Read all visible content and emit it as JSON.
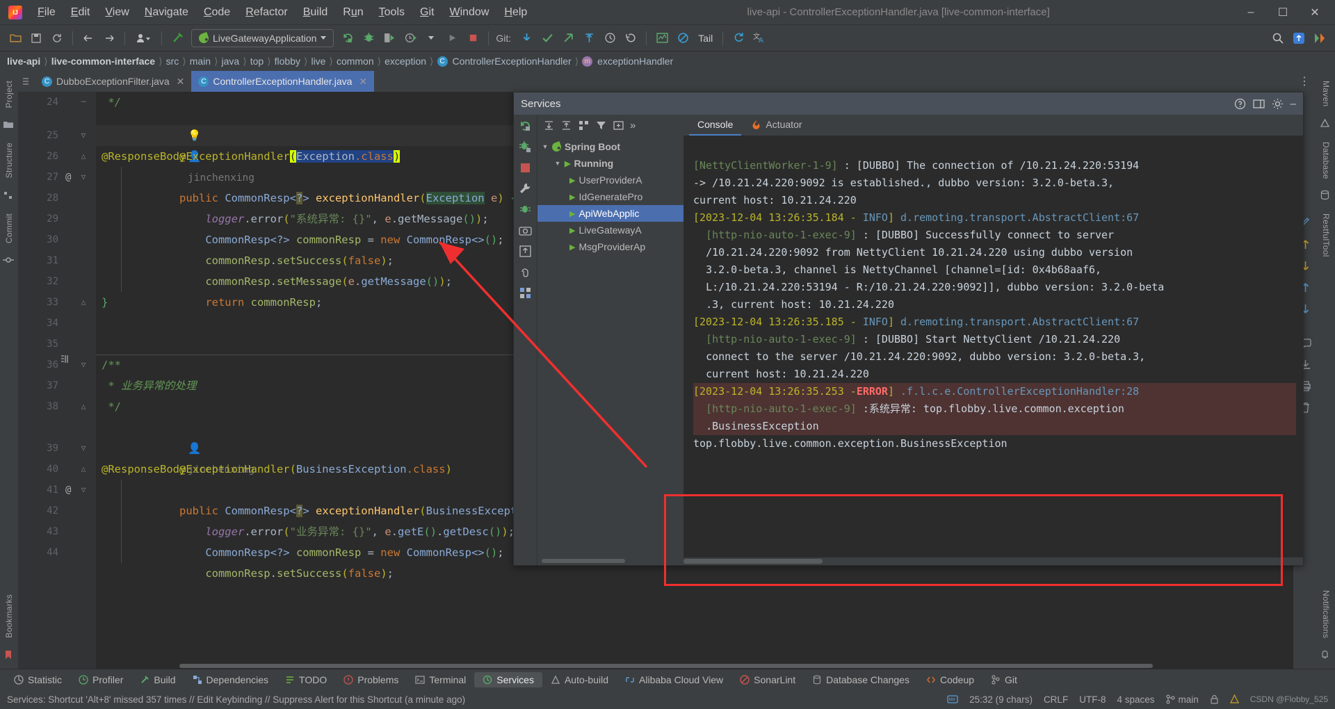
{
  "window": {
    "title": "live-api - ControllerExceptionHandler.java [live-common-interface]",
    "minimize": "–",
    "maximize": "❐",
    "close": "✕"
  },
  "menu": [
    {
      "label": "File",
      "mnemonic": "F"
    },
    {
      "label": "Edit",
      "mnemonic": "E"
    },
    {
      "label": "View",
      "mnemonic": "V"
    },
    {
      "label": "Navigate",
      "mnemonic": "N"
    },
    {
      "label": "Code",
      "mnemonic": "C"
    },
    {
      "label": "Refactor",
      "mnemonic": "R"
    },
    {
      "label": "Build",
      "mnemonic": "B"
    },
    {
      "label": "Run",
      "mnemonic": "u"
    },
    {
      "label": "Tools",
      "mnemonic": "T"
    },
    {
      "label": "Git",
      "mnemonic": "G"
    },
    {
      "label": "Window",
      "mnemonic": "W"
    },
    {
      "label": "Help",
      "mnemonic": "H"
    }
  ],
  "toolbar": {
    "run_config": "LiveGatewayApplication",
    "git_label": "Git:",
    "tail_label": "Tail",
    "icons": [
      "open-folder-icon",
      "save-icon",
      "sync-icon",
      "back-arrow-icon",
      "forward-arrow-icon",
      "profile-icon",
      "build-hammer-icon",
      "run-icon",
      "debug-icon",
      "run-with-coverage-icon",
      "profiler-icon",
      "play-icon",
      "stop-icon",
      "update-project-icon",
      "commit-icon",
      "push-icon",
      "checkout-icon",
      "history-icon",
      "rollback-icon",
      "chart-icon",
      "no-entry-icon",
      "refresh-icon",
      "translate-icon",
      "search-everywhere-icon",
      "notifications-icon",
      "settings-icon"
    ]
  },
  "breadcrumb": [
    {
      "label": "live-api",
      "bold": true,
      "icon": null
    },
    {
      "label": "live-common-interface",
      "bold": true,
      "icon": null
    },
    {
      "label": "src",
      "bold": false,
      "icon": null
    },
    {
      "label": "main",
      "bold": false,
      "icon": null
    },
    {
      "label": "java",
      "bold": false,
      "icon": null
    },
    {
      "label": "top",
      "bold": false,
      "icon": null
    },
    {
      "label": "flobby",
      "bold": false,
      "icon": null
    },
    {
      "label": "live",
      "bold": false,
      "icon": null
    },
    {
      "label": "common",
      "bold": false,
      "icon": null
    },
    {
      "label": "exception",
      "bold": false,
      "icon": null
    },
    {
      "label": "ControllerExceptionHandler",
      "bold": false,
      "icon": "class-icon"
    },
    {
      "label": "exceptionHandler",
      "bold": false,
      "icon": "method-icon"
    }
  ],
  "editor_tabs": [
    {
      "label": "DubboExceptionFilter.java",
      "active": false,
      "icon": "java-class-icon"
    },
    {
      "label": "ControllerExceptionHandler.java",
      "active": true,
      "icon": "java-class-icon"
    }
  ],
  "left_rail": [
    "Project",
    "Structure",
    "Commit",
    "Bookmarks"
  ],
  "right_rail": [
    "Maven",
    "Database",
    "RestfulTool",
    "Notifications"
  ],
  "code": {
    "author_tag": "jinchenxing",
    "lines": [
      {
        "n": "24",
        "text": " */",
        "kind": "comment-end"
      },
      {
        "n": "",
        "text": "jinchenxing",
        "kind": "author"
      },
      {
        "n": "25",
        "text": "@ExceptionHandler(Exception.class)",
        "kind": "annotation-selected"
      },
      {
        "n": "26",
        "text": "@ResponseBody",
        "kind": "annotation"
      },
      {
        "n": "27",
        "text": "public CommonResp<?> exceptionHandler(Exception e) {",
        "kind": "method-decl",
        "gutter_annot": "@"
      },
      {
        "n": "28",
        "text": "    logger.error(\"系统异常: {}\", e.getMessage());",
        "kind": "stmt"
      },
      {
        "n": "29",
        "text": "    CommonResp<?> commonResp = new CommonResp<>();",
        "kind": "stmt"
      },
      {
        "n": "30",
        "text": "    commonResp.setSuccess(false);",
        "kind": "stmt"
      },
      {
        "n": "31",
        "text": "    commonResp.setMessage(e.getMessage());",
        "kind": "stmt"
      },
      {
        "n": "32",
        "text": "    return commonResp;",
        "kind": "stmt"
      },
      {
        "n": "33",
        "text": "}",
        "kind": "brace"
      },
      {
        "n": "34",
        "text": "",
        "kind": "blank"
      },
      {
        "n": "35",
        "text": "",
        "kind": "blank"
      },
      {
        "n": "36",
        "text": "/**",
        "kind": "comment"
      },
      {
        "n": "37",
        "text": " * 业务异常的处理",
        "kind": "comment"
      },
      {
        "n": "38",
        "text": " */",
        "kind": "comment"
      },
      {
        "n": "",
        "text": "jinchenxing",
        "kind": "author"
      },
      {
        "n": "39",
        "text": "@ExceptionHandler(BusinessException.class)",
        "kind": "annotation"
      },
      {
        "n": "40",
        "text": "@ResponseBody",
        "kind": "annotation"
      },
      {
        "n": "41",
        "text": "public CommonResp<?> exceptionHandler(BusinessException e) {",
        "kind": "method-decl",
        "gutter_annot": "@"
      },
      {
        "n": "42",
        "text": "    logger.error(\"业务异常: {}\", e.getE().getDesc());",
        "kind": "stmt"
      },
      {
        "n": "43",
        "text": "    CommonResp<?> commonResp = new CommonResp<>();",
        "kind": "stmt"
      },
      {
        "n": "44",
        "text": "    commonResp.setSuccess(false);",
        "kind": "stmt"
      }
    ]
  },
  "services": {
    "title": "Services",
    "header_icons": [
      "help-icon",
      "layout-icon",
      "settings-icon",
      "minimize-icon"
    ],
    "toolbar_icons": [
      "rerun-icon",
      "debug-icon",
      "stop-icon",
      "settings-wrench-icon",
      "thread-dump-icon",
      "camera-icon",
      "export-icon",
      "attach-icon",
      "grid-icon"
    ],
    "tree_toolbar_icons": [
      "rerun-icon",
      "expand-all-icon",
      "collapse-all-icon",
      "group-icon",
      "filter-icon",
      "add-tab-icon",
      "more-icon"
    ],
    "tree": [
      {
        "label": "Spring Boot",
        "level": 0,
        "expanded": true,
        "icon": "spring-boot-icon",
        "selected": false
      },
      {
        "label": "Running",
        "level": 1,
        "expanded": true,
        "icon": "run-icon",
        "selected": false
      },
      {
        "label": "UserProviderA",
        "level": 2,
        "expanded": false,
        "icon": "run-icon",
        "selected": false
      },
      {
        "label": "IdGeneratePro",
        "level": 2,
        "expanded": false,
        "icon": "run-icon",
        "selected": false
      },
      {
        "label": "ApiWebApplic",
        "level": 2,
        "expanded": false,
        "icon": "run-icon",
        "selected": true
      },
      {
        "label": "LiveGatewayA",
        "level": 2,
        "expanded": false,
        "icon": "run-icon",
        "selected": false
      },
      {
        "label": "MsgProviderAp",
        "level": 2,
        "expanded": false,
        "icon": "run-icon",
        "selected": false
      }
    ],
    "tabs": [
      {
        "label": "Console",
        "active": true,
        "icon": null
      },
      {
        "label": "Actuator",
        "active": false,
        "icon": "actuator-flame-icon"
      }
    ],
    "console_lines": [
      {
        "segments": [
          {
            "t": "[NettyClientWorker-1-9]",
            "c": "thread"
          },
          {
            "t": " : [DUBBO] The connection of /10.21.24.220:53194",
            "c": "plain"
          }
        ]
      },
      {
        "segments": [
          {
            "t": "-> /10.21.24.220:9092 is established., dubbo version: 3.2.0-beta.3,",
            "c": "plain"
          }
        ],
        "indent": 1
      },
      {
        "segments": [
          {
            "t": "current host: 10.21.24.220",
            "c": "plain"
          }
        ],
        "indent": 1
      },
      {
        "segments": [
          {
            "t": "[2023-12-04 13:26:35.184 - ",
            "c": "time"
          },
          {
            "t": "INFO",
            "c": "info"
          },
          {
            "t": "] ",
            "c": "time"
          },
          {
            "t": "d.remoting.transport.AbstractClient:67",
            "c": "logger"
          }
        ]
      },
      {
        "segments": [
          {
            "t": "[http-nio-auto-1-exec-9]",
            "c": "thread"
          },
          {
            "t": " : [DUBBO] Successfully connect to server",
            "c": "plain"
          }
        ],
        "indent": 1
      },
      {
        "segments": [
          {
            "t": "/10.21.24.220:9092 from NettyClient 10.21.24.220 using dubbo version",
            "c": "plain"
          }
        ],
        "indent": 1
      },
      {
        "segments": [
          {
            "t": "3.2.0-beta.3, channel is NettyChannel [channel=[id: 0x4b68aaf6,",
            "c": "plain"
          }
        ],
        "indent": 1
      },
      {
        "segments": [
          {
            "t": "L:/10.21.24.220:53194 - R:/10.21.24.220:9092]], dubbo version: 3.2.0-beta",
            "c": "plain"
          }
        ],
        "indent": 1
      },
      {
        "segments": [
          {
            "t": ".3, current host: 10.21.24.220",
            "c": "plain"
          }
        ],
        "indent": 1
      },
      {
        "segments": [
          {
            "t": "[2023-12-04 13:26:35.185 - ",
            "c": "time"
          },
          {
            "t": "INFO",
            "c": "info"
          },
          {
            "t": "] ",
            "c": "time"
          },
          {
            "t": "d.remoting.transport.AbstractClient:67",
            "c": "logger"
          }
        ]
      },
      {
        "segments": [
          {
            "t": "[http-nio-auto-1-exec-9]",
            "c": "thread"
          },
          {
            "t": " : [DUBBO] Start NettyClient /10.21.24.220",
            "c": "plain"
          }
        ],
        "indent": 1
      },
      {
        "segments": [
          {
            "t": "connect to the server /10.21.24.220:9092, dubbo version: 3.2.0-beta.3,",
            "c": "plain"
          }
        ],
        "indent": 1
      },
      {
        "segments": [
          {
            "t": "current host: 10.21.24.220",
            "c": "plain"
          }
        ],
        "indent": 1
      }
    ],
    "error_lines": [
      {
        "segments": [
          {
            "t": "[2023-12-04 13:26:35.253 -",
            "c": "time"
          },
          {
            "t": "ERROR",
            "c": "err"
          },
          {
            "t": "] ",
            "c": "time"
          },
          {
            "t": ".f.l.c.e.ControllerExceptionHandler:28",
            "c": "logger"
          }
        ],
        "highlight": true
      },
      {
        "segments": [
          {
            "t": "[http-nio-auto-1-exec-9]",
            "c": "thread"
          },
          {
            "t": " :系统异常: top.flobby.live.common.exception",
            "c": "plain"
          }
        ],
        "indent": 1,
        "highlight": true
      },
      {
        "segments": [
          {
            "t": ".BusinessException",
            "c": "plain"
          }
        ],
        "indent": 1,
        "highlight": true
      },
      {
        "segments": [
          {
            "t": "top.flobby.live.common.exception.BusinessException",
            "c": "plain"
          }
        ],
        "highlight": false
      }
    ]
  },
  "toolwindow_bar": [
    {
      "label": "Statistic",
      "icon": "statistic-icon",
      "active": false
    },
    {
      "label": "Profiler",
      "icon": "profiler-icon",
      "active": false
    },
    {
      "label": "Build",
      "icon": "build-icon",
      "active": false
    },
    {
      "label": "Dependencies",
      "icon": "dependencies-icon",
      "active": false
    },
    {
      "label": "TODO",
      "icon": "todo-icon",
      "active": false
    },
    {
      "label": "Problems",
      "icon": "problems-icon",
      "active": false
    },
    {
      "label": "Terminal",
      "icon": "terminal-icon",
      "active": false
    },
    {
      "label": "Services",
      "icon": "services-icon",
      "active": true
    },
    {
      "label": "Auto-build",
      "icon": "autobuild-icon",
      "active": false
    },
    {
      "label": "Alibaba Cloud View",
      "icon": "alibaba-icon",
      "active": false
    },
    {
      "label": "SonarLint",
      "icon": "sonarlint-icon",
      "active": false
    },
    {
      "label": "Database Changes",
      "icon": "database-icon",
      "active": false
    },
    {
      "label": "Codeup",
      "icon": "codeup-icon",
      "active": false
    },
    {
      "label": "Git",
      "icon": "git-icon",
      "active": false
    }
  ],
  "statusbar": {
    "message": "Services: Shortcut 'Alt+8' missed 357 times // Edit Keybinding // Suppress Alert for this Shortcut (a minute ago)",
    "position": "25:32 (9 chars)",
    "line_sep": "CRLF",
    "encoding": "UTF-8",
    "indent": "4 spaces",
    "branch": "main",
    "watermark": "CSDN @Flobby_525",
    "icons": [
      "memory-icon",
      "lock-icon",
      "branch-icon",
      "inspection-icon",
      "notification-icon"
    ]
  }
}
